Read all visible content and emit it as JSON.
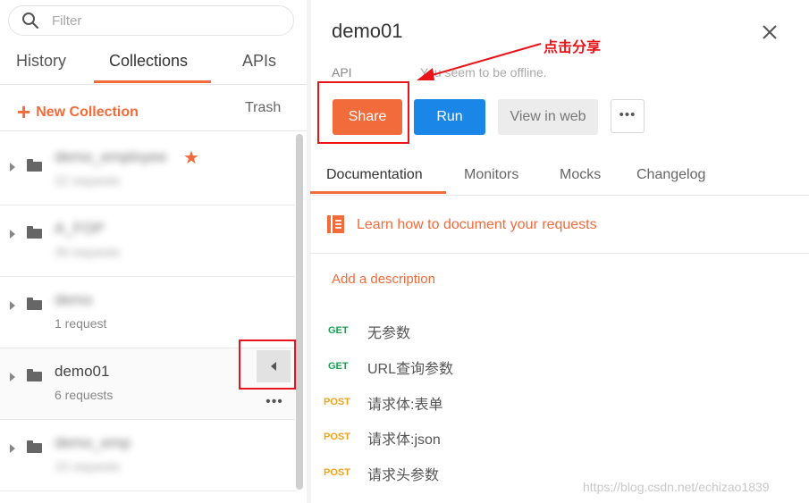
{
  "sidebar": {
    "search_placeholder": "Filter",
    "tabs": [
      "History",
      "Collections",
      "APIs"
    ],
    "new_collection": "New Collection",
    "trash": "Trash",
    "collections": [
      {
        "name": "demo_employee",
        "sub": "22 requests",
        "starred": true,
        "blurred": true
      },
      {
        "name": "A_FOP",
        "sub": "39 requests",
        "blurred": true
      },
      {
        "name": "demo",
        "sub": "1 request",
        "blurred": true
      },
      {
        "name": "demo01",
        "sub": "6 requests",
        "blurred": false
      },
      {
        "name": "demo_emp",
        "sub": "15 requests",
        "blurred": true
      }
    ],
    "more_label": "•••"
  },
  "main": {
    "title": "demo01",
    "api_label": "API",
    "offline_text": "You seem to be offline.",
    "annotation": "点击分享",
    "buttons": {
      "share": "Share",
      "run": "Run",
      "view_in_web": "View in web",
      "more": "•••"
    },
    "tabs": [
      "Documentation",
      "Monitors",
      "Mocks",
      "Changelog"
    ],
    "learn_link": "Learn how to document your requests",
    "add_description": "Add a description",
    "requests": [
      {
        "method": "GET",
        "name": "无参数"
      },
      {
        "method": "GET",
        "name": "URL查询参数"
      },
      {
        "method": "POST",
        "name": "请求体:表单"
      },
      {
        "method": "POST",
        "name": "请求体:json"
      },
      {
        "method": "POST",
        "name": "请求头参数"
      }
    ]
  },
  "watermark": "https://blog.csdn.net/echizao1839",
  "colors": {
    "accent": "#f26b3a",
    "run_blue": "#1a86e8",
    "annotation_red": "#e8141a",
    "get": "#1e9e57",
    "post": "#f3a218"
  }
}
